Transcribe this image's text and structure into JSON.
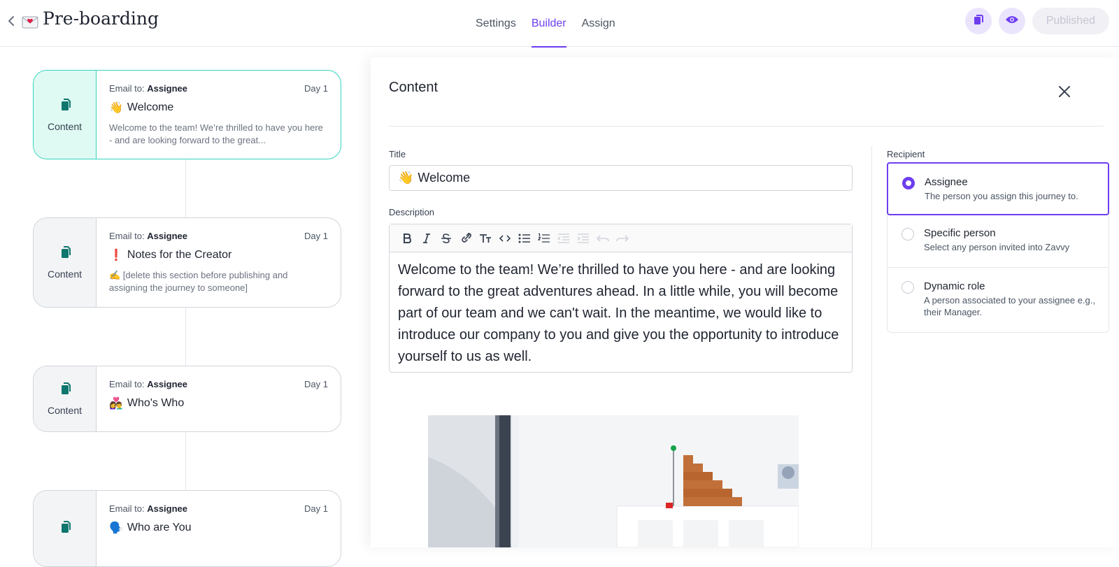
{
  "header": {
    "title": "Pre-boarding",
    "tabs": [
      {
        "label": "Settings"
      },
      {
        "label": "Builder"
      },
      {
        "label": "Assign"
      }
    ],
    "publish_label": "Published"
  },
  "cards": [
    {
      "type_label": "Content",
      "email_prefix": "Email to:",
      "email_target": "Assignee",
      "day": "Day 1",
      "emoji": "👋",
      "title": "Welcome",
      "desc": "Welcome to the team! We’re thrilled to have you here - and are looking forward to the great..."
    },
    {
      "type_label": "Content",
      "email_prefix": "Email to:",
      "email_target": "Assignee",
      "day": "Day 1",
      "emoji": "❗",
      "title": "Notes for the Creator",
      "desc": "✍️ [delete this section before publishing and assigning the journey to someone]"
    },
    {
      "type_label": "Content",
      "email_prefix": "Email to:",
      "email_target": "Assignee",
      "day": "Day 1",
      "emoji": "👩‍❤️‍👨",
      "title": "Who's Who",
      "desc": ""
    },
    {
      "type_label": "",
      "email_prefix": "Email to:",
      "email_target": "Assignee",
      "day": "Day 1",
      "emoji": "🗣️",
      "title": "Who are You",
      "desc": ""
    }
  ],
  "panel": {
    "title": "Content",
    "title_field_label": "Title",
    "title_value_emoji": "👋",
    "title_value": "Welcome",
    "description_label": "Description",
    "description_text": "Welcome to the team! We’re thrilled to have you here - and are looking forward to the great adventures ahead. In a little while, you will become part of our team and we can't wait. In the meantime, we would like to introduce our company to you and give you the opportunity to introduce yourself to us as well.",
    "toolbar": [
      "bold-icon",
      "italic-icon",
      "strikethrough-icon",
      "link-icon",
      "text-size-icon",
      "code-icon",
      "bullet-list-icon",
      "numbered-list-icon",
      "outdent-icon",
      "indent-icon",
      "undo-icon",
      "redo-icon"
    ],
    "recipient_label": "Recipient",
    "recipients": [
      {
        "title": "Assignee",
        "sub": "The person you assign this journey to.",
        "selected": true
      },
      {
        "title": "Specific person",
        "sub": "Select any person invited into Zavvy",
        "selected": false
      },
      {
        "title": "Dynamic role",
        "sub": "A person associated to your assignee e.g., their Manager.",
        "selected": false
      }
    ]
  },
  "colors": {
    "accent": "#6d3ef0",
    "teal": "#34d3bd",
    "icon_teal": "#0f766e"
  }
}
